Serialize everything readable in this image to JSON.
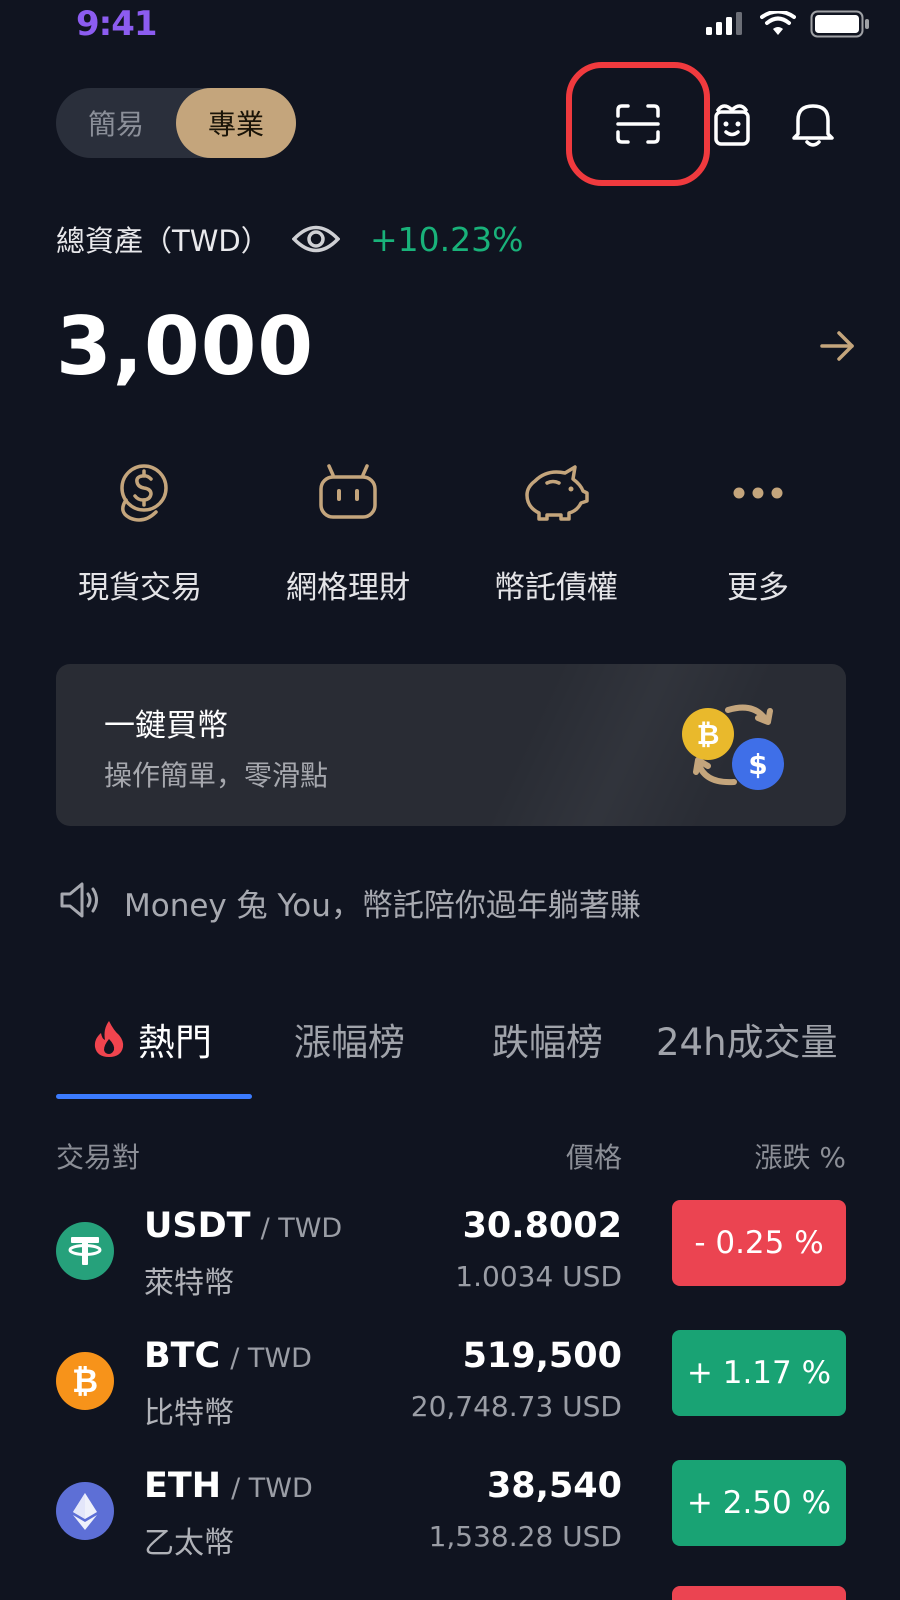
{
  "status_bar": {
    "time": "9:41"
  },
  "mode_toggle": {
    "options": [
      "簡易",
      "專業"
    ],
    "selected": "專業"
  },
  "assets": {
    "label": "總資產（TWD）",
    "change": "+10.23%",
    "value": "3,000"
  },
  "quick_actions": [
    {
      "label": "現貨交易",
      "icon": "coins-icon"
    },
    {
      "label": "網格理財",
      "icon": "robot-icon"
    },
    {
      "label": "幣託債權",
      "icon": "piggy-bank-icon"
    },
    {
      "label": "更多",
      "icon": "more-icon"
    }
  ],
  "banner": {
    "title": "一鍵買幣",
    "subtitle": "操作簡單，零滑點"
  },
  "announcement": {
    "text": "Money 兔 You，幣託陪你過年躺著賺"
  },
  "market_tabs": [
    {
      "label": "熱門",
      "active": true
    },
    {
      "label": "漲幅榜",
      "active": false
    },
    {
      "label": "跌幅榜",
      "active": false
    },
    {
      "label": "24h成交量",
      "active": false
    }
  ],
  "table": {
    "headers": {
      "pair": "交易對",
      "price": "價格",
      "change": "漲跌 %"
    },
    "rows": [
      {
        "symbol": "USDT",
        "quote": "/ TWD",
        "name": "萊特幣",
        "price": "30.8002",
        "usd": "1.0034 USD",
        "change": "- 0.25 %",
        "direction": "down",
        "icon_color": "#26a17b"
      },
      {
        "symbol": "BTC",
        "quote": "/ TWD",
        "name": "比特幣",
        "price": "519,500",
        "usd": "20,748.73 USD",
        "change": "+ 1.17 %",
        "direction": "up",
        "icon_color": "#f7931a"
      },
      {
        "symbol": "ETH",
        "quote": "/ TWD",
        "name": "乙太幣",
        "price": "38,540",
        "usd": "1,538.28 USD",
        "change": "+ 2.50 %",
        "direction": "up",
        "icon_color": "#5d6fd6"
      }
    ]
  },
  "colors": {
    "background": "#101420",
    "accent_gold": "#c4a57c",
    "positive": "#19a374",
    "negative": "#eb4451",
    "tab_indicator": "#3b7bff",
    "highlight_box": "#f03a3e"
  }
}
